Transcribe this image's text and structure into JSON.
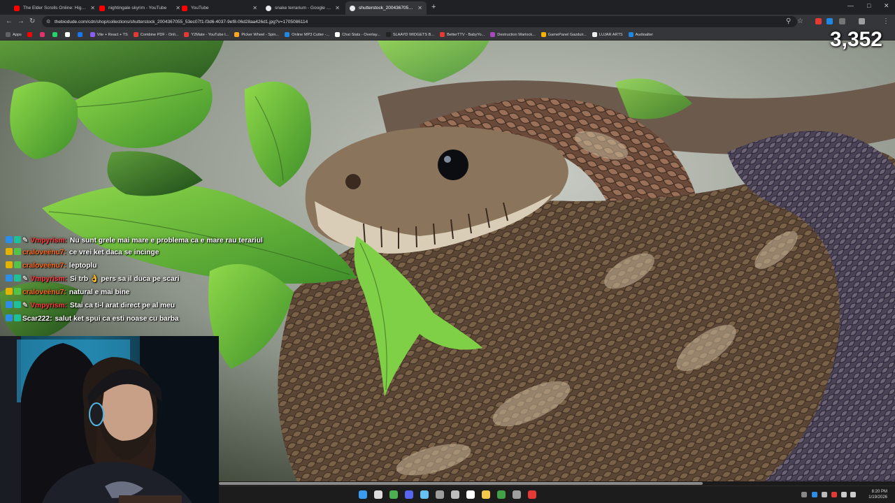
{
  "browser": {
    "tabs": [
      {
        "label": "The Elder Scrolls Online: High I...",
        "icon": "youtube-icon",
        "active": false
      },
      {
        "label": "nightingale skyrim - YouTube",
        "icon": "youtube-icon",
        "active": false
      },
      {
        "label": "YouTube",
        "icon": "youtube-icon",
        "active": false
      },
      {
        "label": "snake terrarium - Google Sear...",
        "icon": "google-icon",
        "active": false
      },
      {
        "label": "shutterstock_2004367055_53ec...",
        "icon": "globe-icon",
        "active": true
      }
    ],
    "new_tab_glyph": "+",
    "url": "thebiodude.com/cdn/shop/collections/shutterstock_2004367055_53ec07f1-f3d6-4037-9ef8-06d28aa426d1.jpg?v=1705086114",
    "bookmarks": [
      {
        "label": "Apps",
        "color": "#5f6368"
      },
      {
        "label": "",
        "color": "#ff0000"
      },
      {
        "label": "",
        "color": "#e1306c"
      },
      {
        "label": "",
        "color": "#25d366"
      },
      {
        "label": "",
        "color": "#ffffff"
      },
      {
        "label": "",
        "color": "#1877f2"
      },
      {
        "label": "Vite + React + TS",
        "color": "#8b5cf6"
      },
      {
        "label": "Combine PDF - Onli...",
        "color": "#e53935"
      },
      {
        "label": "Y2Mate - YouTube t...",
        "color": "#e53935"
      },
      {
        "label": "Picker Wheel - Spin...",
        "color": "#f9a825"
      },
      {
        "label": "Online MP3 Cutter -...",
        "color": "#1e88e5"
      },
      {
        "label": "Chat Stats - Overlay...",
        "color": "#ffffff"
      },
      {
        "label": "SLAAYD WIDGETS B...",
        "color": "#222222"
      },
      {
        "label": "BetterTTV - BabyYo...",
        "color": "#e53935"
      },
      {
        "label": "Destruction Warlock...",
        "color": "#ab47bc"
      },
      {
        "label": "GamePanel Gazduir...",
        "color": "#ffb300"
      },
      {
        "label": "LUJAR ARTS",
        "color": "#eeeeee"
      },
      {
        "label": "Audioalter",
        "color": "#1e88e5"
      }
    ]
  },
  "overlay": {
    "viewer_count": "3,352"
  },
  "chat": [
    {
      "badges": [
        "blue",
        "teal",
        "tool"
      ],
      "user": "Vmpyrism:",
      "user_color": "#ff3b3b",
      "message": "Nu sunt grele mai mare e problema ca e mare rau terariul",
      "wrap": true
    },
    {
      "badges": [
        "gold",
        "green"
      ],
      "user": "craloveènu7:",
      "user_color": "#ff6a1a",
      "message": "ce vrei ket daca se incinge",
      "wrap": false
    },
    {
      "badges": [
        "gold",
        "green"
      ],
      "user": "craloveènu7:",
      "user_color": "#ff6a1a",
      "message": "leptoplu",
      "wrap": false
    },
    {
      "badges": [
        "blue",
        "teal",
        "tool"
      ],
      "user": "Vmpyrism:",
      "user_color": "#ff3b3b",
      "message": "Si trb 👌 pers sa il duca pe scari",
      "wrap": false
    },
    {
      "badges": [
        "gold",
        "green"
      ],
      "user": "craloveènu7:",
      "user_color": "#ff6a1a",
      "message": "natural e mai bine",
      "wrap": false
    },
    {
      "badges": [
        "blue",
        "teal",
        "tool"
      ],
      "user": "Vmpyrism:",
      "user_color": "#ff3b3b",
      "message": "Stai ca ti-l arat direct pe al meu",
      "wrap": false
    },
    {
      "badges": [
        "blue",
        "teal"
      ],
      "user": "Scar222:",
      "user_color": "#ffffff",
      "message": "salut ket spui ca esti noase cu barba",
      "wrap": false
    }
  ],
  "taskbar": {
    "time": "8:20 PM",
    "date": "1/19/2026",
    "apps": [
      {
        "name": "windows-start-icon",
        "color": "#3a9cf0"
      },
      {
        "name": "search-icon",
        "color": "#dddddd"
      },
      {
        "name": "chrome-icon",
        "color": "#4caf50"
      },
      {
        "name": "discord-icon",
        "color": "#5865f2"
      },
      {
        "name": "steam-icon",
        "color": "#66c0f4"
      },
      {
        "name": "calculator-icon",
        "color": "#9e9e9e"
      },
      {
        "name": "app-icon",
        "color": "#bdbdbd"
      },
      {
        "name": "capcut-icon",
        "color": "#ffffff"
      },
      {
        "name": "file-explorer-icon",
        "color": "#f7c948"
      },
      {
        "name": "xbox-icon",
        "color": "#43a047"
      },
      {
        "name": "settings-icon",
        "color": "#9e9e9e"
      },
      {
        "name": "security-icon",
        "color": "#e53935"
      }
    ]
  }
}
